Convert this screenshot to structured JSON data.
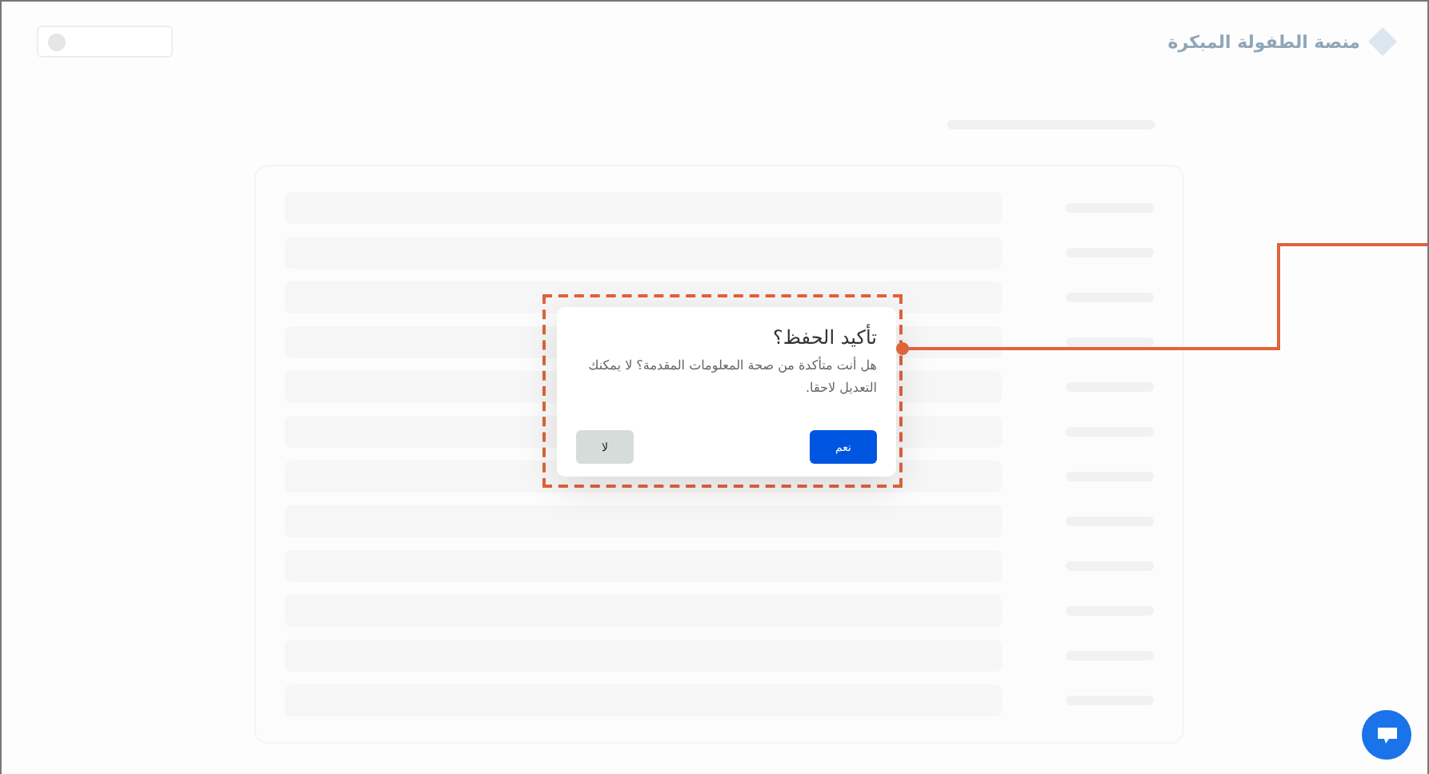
{
  "header": {
    "logo_text": "منصة الطفولة المبكرة"
  },
  "dialog": {
    "title": "تأكيد الحفظ؟",
    "message": "هل أنت متأكدة من صحة المعلومات المقدمة؟ لا يمكنك التعديل لاحقا.",
    "buttons": [
      {
        "label": "نعم",
        "kind": "primary"
      },
      {
        "label": "لا",
        "kind": "secondary"
      }
    ]
  }
}
